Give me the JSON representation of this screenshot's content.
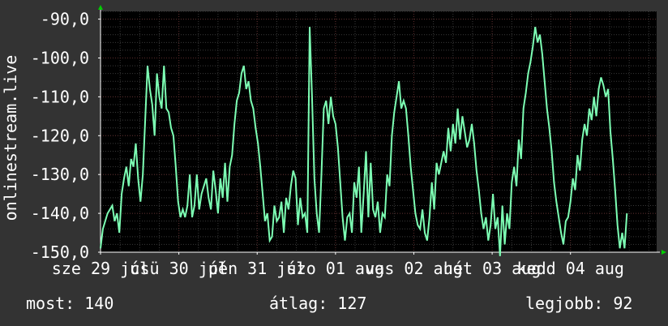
{
  "y_axis_title": "onlinestream.live",
  "footer": {
    "now": "most: 140",
    "avg": "átlag: 127",
    "best": "legjobb: 92"
  },
  "colors": {
    "background": "#333333",
    "plot_background": "#000000",
    "grid_minor": "#3a3a3a",
    "grid_major": "#5a2a2a",
    "line": "#7dffb4",
    "text": "#ffffff",
    "arrow": "#00cc00"
  },
  "chart_data": {
    "type": "line",
    "title": "",
    "xlabel": "",
    "ylabel": "onlinestream.live",
    "ylim": [
      -150,
      -88
    ],
    "yticks": [
      -90,
      -100,
      -110,
      -120,
      -130,
      -140,
      -150
    ],
    "ytick_labels": [
      "-90,0",
      "-100,0",
      "-110,0",
      "-120,0",
      "-130,0",
      "-140,0",
      "-150,0"
    ],
    "xticks": [
      {
        "label": "sze 29 júl",
        "x": 0
      },
      {
        "label": "csü 30 júl",
        "x": 1
      },
      {
        "label": "pén 31 júl",
        "x": 2
      },
      {
        "label": "szo 01 aug",
        "x": 3
      },
      {
        "label": "vas 02 aug",
        "x": 4
      },
      {
        "label": "hét 03 aug",
        "x": 5
      },
      {
        "label": "kedd 04 aug",
        "x": 6
      }
    ],
    "xlim": [
      0,
      7.1
    ],
    "grid": true,
    "series": [
      {
        "values": [
          [
            0.0,
            -149
          ],
          [
            0.03,
            -144
          ],
          [
            0.06,
            -142
          ],
          [
            0.09,
            -140
          ],
          [
            0.12,
            -139
          ],
          [
            0.15,
            -138
          ],
          [
            0.18,
            -142
          ],
          [
            0.21,
            -140
          ],
          [
            0.24,
            -145
          ],
          [
            0.27,
            -135
          ],
          [
            0.3,
            -131
          ],
          [
            0.33,
            -128
          ],
          [
            0.36,
            -133
          ],
          [
            0.39,
            -126
          ],
          [
            0.42,
            -128
          ],
          [
            0.45,
            -122
          ],
          [
            0.48,
            -131
          ],
          [
            0.51,
            -137
          ],
          [
            0.54,
            -130
          ],
          [
            0.57,
            -116
          ],
          [
            0.6,
            -102
          ],
          [
            0.63,
            -108
          ],
          [
            0.66,
            -112
          ],
          [
            0.69,
            -120
          ],
          [
            0.72,
            -104
          ],
          [
            0.75,
            -110
          ],
          [
            0.78,
            -113
          ],
          [
            0.81,
            -102
          ],
          [
            0.84,
            -113
          ],
          [
            0.87,
            -114
          ],
          [
            0.9,
            -118
          ],
          [
            0.93,
            -120
          ],
          [
            0.96,
            -128
          ],
          [
            0.99,
            -137
          ],
          [
            1.02,
            -141
          ],
          [
            1.05,
            -139
          ],
          [
            1.08,
            -141
          ],
          [
            1.11,
            -138
          ],
          [
            1.14,
            -130
          ],
          [
            1.17,
            -141
          ],
          [
            1.2,
            -138
          ],
          [
            1.23,
            -130
          ],
          [
            1.26,
            -139
          ],
          [
            1.29,
            -135
          ],
          [
            1.32,
            -133
          ],
          [
            1.35,
            -131
          ],
          [
            1.38,
            -136
          ],
          [
            1.41,
            -139
          ],
          [
            1.44,
            -129
          ],
          [
            1.47,
            -134
          ],
          [
            1.5,
            -140
          ],
          [
            1.53,
            -131
          ],
          [
            1.56,
            -136
          ],
          [
            1.59,
            -127
          ],
          [
            1.62,
            -137
          ],
          [
            1.65,
            -128
          ],
          [
            1.68,
            -125
          ],
          [
            1.71,
            -117
          ],
          [
            1.74,
            -111
          ],
          [
            1.77,
            -109
          ],
          [
            1.8,
            -104
          ],
          [
            1.83,
            -102
          ],
          [
            1.86,
            -108
          ],
          [
            1.89,
            -106
          ],
          [
            1.92,
            -111
          ],
          [
            1.95,
            -113
          ],
          [
            1.98,
            -118
          ],
          [
            2.01,
            -122
          ],
          [
            2.04,
            -128
          ],
          [
            2.07,
            -135
          ],
          [
            2.1,
            -142
          ],
          [
            2.13,
            -140
          ],
          [
            2.16,
            -147
          ],
          [
            2.19,
            -146
          ],
          [
            2.22,
            -138
          ],
          [
            2.25,
            -142
          ],
          [
            2.28,
            -141
          ],
          [
            2.31,
            -137
          ],
          [
            2.34,
            -145
          ],
          [
            2.37,
            -136
          ],
          [
            2.4,
            -139
          ],
          [
            2.43,
            -133
          ],
          [
            2.46,
            -129
          ],
          [
            2.49,
            -131
          ],
          [
            2.52,
            -143
          ],
          [
            2.55,
            -136
          ],
          [
            2.58,
            -141
          ],
          [
            2.61,
            -140
          ],
          [
            2.64,
            -145
          ],
          [
            2.67,
            -92
          ],
          [
            2.7,
            -110
          ],
          [
            2.73,
            -131
          ],
          [
            2.76,
            -140
          ],
          [
            2.79,
            -145
          ],
          [
            2.82,
            -130
          ],
          [
            2.85,
            -113
          ],
          [
            2.88,
            -111
          ],
          [
            2.91,
            -117
          ],
          [
            2.94,
            -110
          ],
          [
            2.97,
            -115
          ],
          [
            3.0,
            -117
          ],
          [
            3.03,
            -123
          ],
          [
            3.06,
            -132
          ],
          [
            3.09,
            -141
          ],
          [
            3.12,
            -147
          ],
          [
            3.15,
            -141
          ],
          [
            3.18,
            -140
          ],
          [
            3.21,
            -145
          ],
          [
            3.24,
            -132
          ],
          [
            3.27,
            -136
          ],
          [
            3.3,
            -128
          ],
          [
            3.33,
            -145
          ],
          [
            3.36,
            -135
          ],
          [
            3.39,
            -124
          ],
          [
            3.42,
            -141
          ],
          [
            3.45,
            -127
          ],
          [
            3.48,
            -139
          ],
          [
            3.51,
            -141
          ],
          [
            3.54,
            -137
          ],
          [
            3.57,
            -145
          ],
          [
            3.6,
            -140
          ],
          [
            3.63,
            -141
          ],
          [
            3.66,
            -130
          ],
          [
            3.69,
            -133
          ],
          [
            3.72,
            -120
          ],
          [
            3.75,
            -114
          ],
          [
            3.78,
            -110
          ],
          [
            3.81,
            -106
          ],
          [
            3.84,
            -113
          ],
          [
            3.87,
            -111
          ],
          [
            3.9,
            -113
          ],
          [
            3.93,
            -120
          ],
          [
            3.96,
            -128
          ],
          [
            3.99,
            -134
          ],
          [
            4.02,
            -140
          ],
          [
            4.05,
            -143
          ],
          [
            4.08,
            -144
          ],
          [
            4.11,
            -139
          ],
          [
            4.14,
            -145
          ],
          [
            4.17,
            -147
          ],
          [
            4.2,
            -141
          ],
          [
            4.23,
            -132
          ],
          [
            4.26,
            -139
          ],
          [
            4.29,
            -127
          ],
          [
            4.32,
            -130
          ],
          [
            4.35,
            -127
          ],
          [
            4.38,
            -124
          ],
          [
            4.41,
            -127
          ],
          [
            4.44,
            -118
          ],
          [
            4.47,
            -124
          ],
          [
            4.5,
            -117
          ],
          [
            4.53,
            -122
          ],
          [
            4.56,
            -113
          ],
          [
            4.59,
            -121
          ],
          [
            4.62,
            -115
          ],
          [
            4.65,
            -119
          ],
          [
            4.68,
            -123
          ],
          [
            4.71,
            -121
          ],
          [
            4.74,
            -117
          ],
          [
            4.77,
            -122
          ],
          [
            4.8,
            -129
          ],
          [
            4.83,
            -134
          ],
          [
            4.86,
            -140
          ],
          [
            4.89,
            -144
          ],
          [
            4.92,
            -141
          ],
          [
            4.95,
            -147
          ],
          [
            4.98,
            -143
          ],
          [
            5.01,
            -135
          ],
          [
            5.04,
            -144
          ],
          [
            5.07,
            -141
          ],
          [
            5.1,
            -151
          ],
          [
            5.13,
            -138
          ],
          [
            5.16,
            -148
          ],
          [
            5.19,
            -140
          ],
          [
            5.22,
            -144
          ],
          [
            5.25,
            -132
          ],
          [
            5.28,
            -128
          ],
          [
            5.31,
            -133
          ],
          [
            5.34,
            -121
          ],
          [
            5.37,
            -126
          ],
          [
            5.4,
            -113
          ],
          [
            5.43,
            -109
          ],
          [
            5.46,
            -104
          ],
          [
            5.49,
            -101
          ],
          [
            5.52,
            -97
          ],
          [
            5.55,
            -92
          ],
          [
            5.58,
            -96
          ],
          [
            5.61,
            -94
          ],
          [
            5.64,
            -99
          ],
          [
            5.67,
            -106
          ],
          [
            5.7,
            -113
          ],
          [
            5.73,
            -118
          ],
          [
            5.76,
            -124
          ],
          [
            5.79,
            -132
          ],
          [
            5.82,
            -137
          ],
          [
            5.85,
            -141
          ],
          [
            5.88,
            -145
          ],
          [
            5.91,
            -148
          ],
          [
            5.94,
            -142
          ],
          [
            5.97,
            -141
          ],
          [
            6.0,
            -137
          ],
          [
            6.03,
            -131
          ],
          [
            6.06,
            -134
          ],
          [
            6.09,
            -125
          ],
          [
            6.12,
            -129
          ],
          [
            6.15,
            -121
          ],
          [
            6.18,
            -117
          ],
          [
            6.21,
            -120
          ],
          [
            6.24,
            -113
          ],
          [
            6.27,
            -116
          ],
          [
            6.3,
            -110
          ],
          [
            6.33,
            -115
          ],
          [
            6.36,
            -108
          ],
          [
            6.39,
            -105
          ],
          [
            6.42,
            -107
          ],
          [
            6.45,
            -110
          ],
          [
            6.48,
            -108
          ],
          [
            6.51,
            -119
          ],
          [
            6.54,
            -126
          ],
          [
            6.57,
            -134
          ],
          [
            6.6,
            -143
          ],
          [
            6.63,
            -149
          ],
          [
            6.66,
            -145
          ],
          [
            6.69,
            -149
          ],
          [
            6.72,
            -140
          ]
        ]
      }
    ]
  }
}
